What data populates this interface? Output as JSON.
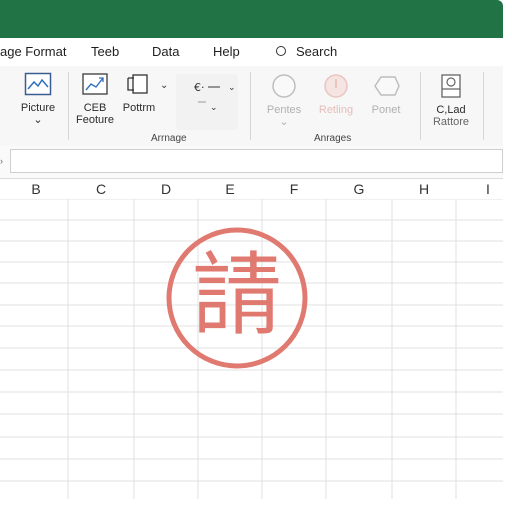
{
  "menu": {
    "items": [
      "age Format",
      "Teeb",
      "Data",
      "Help"
    ],
    "search_label": "Search"
  },
  "ribbon": {
    "buttons": [
      {
        "label": "Picture",
        "sub": "⌄",
        "icon": "picture-icon"
      },
      {
        "label": "CEB",
        "sub": "Feoture",
        "icon": "chart-feature-icon"
      },
      {
        "label": "Pottrm",
        "sub": "",
        "icon": "pattern-icon"
      },
      {
        "label": "",
        "sub": "",
        "icon": "align-icon"
      },
      {
        "label": "Pentes",
        "sub": "⌄",
        "icon": "shape-circle-icon"
      },
      {
        "label": "Retling",
        "sub": "",
        "icon": "retouch-icon"
      },
      {
        "label": "Ponet",
        "sub": "",
        "icon": "pointer-shape-icon"
      },
      {
        "label": "C,Lad",
        "sub": "Rattore",
        "icon": "restore-icon"
      }
    ],
    "groups": [
      "Arrnage",
      "Anrages"
    ]
  },
  "columns": [
    "B",
    "C",
    "D",
    "E",
    "F",
    "G",
    "H",
    "I"
  ],
  "stamp": {
    "glyph": "請",
    "color": "#e07a70"
  },
  "colors": {
    "titlebar": "#217346",
    "stamp": "#e07a70"
  }
}
